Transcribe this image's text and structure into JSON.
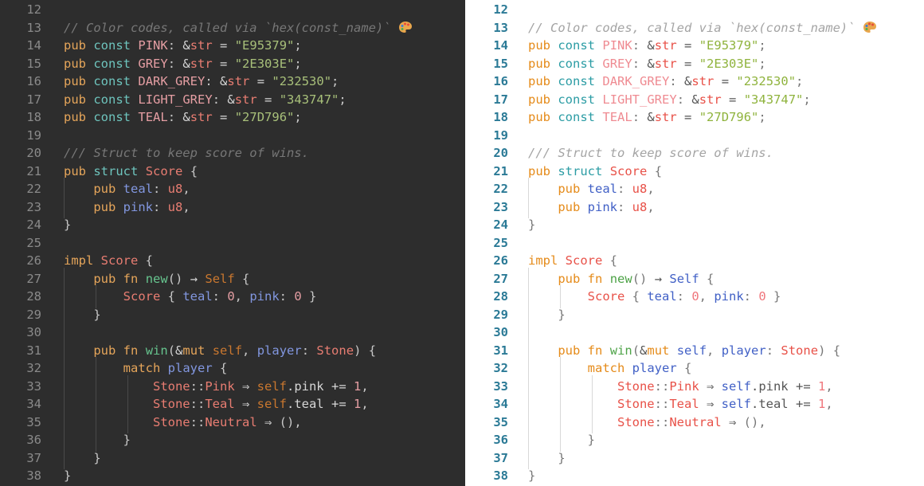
{
  "panels": [
    {
      "theme": "dark",
      "name": "dark-theme-editor"
    },
    {
      "theme": "light",
      "name": "light-theme-editor"
    }
  ],
  "lines": [
    {
      "n": "12",
      "tokens": []
    },
    {
      "n": "13",
      "tokens": [
        [
          "comment",
          "// Color codes, called via `hex(const_name)` "
        ],
        [
          "emoji",
          "palette"
        ]
      ]
    },
    {
      "n": "14",
      "tokens": [
        [
          "kw",
          "pub"
        ],
        [
          "plain",
          " "
        ],
        [
          "kw2",
          "const"
        ],
        [
          "plain",
          " "
        ],
        [
          "const",
          "PINK"
        ],
        [
          "punct",
          ": "
        ],
        [
          "plain",
          "&"
        ],
        [
          "type",
          "str"
        ],
        [
          "op",
          " = "
        ],
        [
          "string",
          "\"E95379\""
        ],
        [
          "punct",
          ";"
        ]
      ]
    },
    {
      "n": "15",
      "tokens": [
        [
          "kw",
          "pub"
        ],
        [
          "plain",
          " "
        ],
        [
          "kw2",
          "const"
        ],
        [
          "plain",
          " "
        ],
        [
          "const",
          "GREY"
        ],
        [
          "punct",
          ": "
        ],
        [
          "plain",
          "&"
        ],
        [
          "type",
          "str"
        ],
        [
          "op",
          " = "
        ],
        [
          "string",
          "\"2E303E\""
        ],
        [
          "punct",
          ";"
        ]
      ]
    },
    {
      "n": "16",
      "tokens": [
        [
          "kw",
          "pub"
        ],
        [
          "plain",
          " "
        ],
        [
          "kw2",
          "const"
        ],
        [
          "plain",
          " "
        ],
        [
          "const",
          "DARK_GREY"
        ],
        [
          "punct",
          ": "
        ],
        [
          "plain",
          "&"
        ],
        [
          "type",
          "str"
        ],
        [
          "op",
          " = "
        ],
        [
          "string",
          "\"232530\""
        ],
        [
          "punct",
          ";"
        ]
      ]
    },
    {
      "n": "17",
      "tokens": [
        [
          "kw",
          "pub"
        ],
        [
          "plain",
          " "
        ],
        [
          "kw2",
          "const"
        ],
        [
          "plain",
          " "
        ],
        [
          "const",
          "LIGHT_GREY"
        ],
        [
          "punct",
          ": "
        ],
        [
          "plain",
          "&"
        ],
        [
          "type",
          "str"
        ],
        [
          "op",
          " = "
        ],
        [
          "string",
          "\"343747\""
        ],
        [
          "punct",
          ";"
        ]
      ]
    },
    {
      "n": "18",
      "tokens": [
        [
          "kw",
          "pub"
        ],
        [
          "plain",
          " "
        ],
        [
          "kw2",
          "const"
        ],
        [
          "plain",
          " "
        ],
        [
          "const",
          "TEAL"
        ],
        [
          "punct",
          ": "
        ],
        [
          "plain",
          "&"
        ],
        [
          "type",
          "str"
        ],
        [
          "op",
          " = "
        ],
        [
          "string",
          "\"27D796\""
        ],
        [
          "punct",
          ";"
        ]
      ]
    },
    {
      "n": "19",
      "tokens": []
    },
    {
      "n": "20",
      "tokens": [
        [
          "comment",
          "/// Struct to keep score of wins."
        ]
      ]
    },
    {
      "n": "21",
      "tokens": [
        [
          "kw",
          "pub"
        ],
        [
          "plain",
          " "
        ],
        [
          "kw2",
          "struct"
        ],
        [
          "plain",
          " "
        ],
        [
          "type",
          "Score"
        ],
        [
          "punct",
          " {"
        ]
      ]
    },
    {
      "n": "22",
      "guides": [
        0
      ],
      "tokens": [
        [
          "plain",
          "    "
        ],
        [
          "kw",
          "pub"
        ],
        [
          "plain",
          " "
        ],
        [
          "field",
          "teal"
        ],
        [
          "punct",
          ": "
        ],
        [
          "type",
          "u8"
        ],
        [
          "punct",
          ","
        ]
      ]
    },
    {
      "n": "23",
      "guides": [
        0
      ],
      "tokens": [
        [
          "plain",
          "    "
        ],
        [
          "kw",
          "pub"
        ],
        [
          "plain",
          " "
        ],
        [
          "field",
          "pink"
        ],
        [
          "punct",
          ": "
        ],
        [
          "type",
          "u8"
        ],
        [
          "punct",
          ","
        ]
      ]
    },
    {
      "n": "24",
      "tokens": [
        [
          "punct",
          "}"
        ]
      ]
    },
    {
      "n": "25",
      "tokens": []
    },
    {
      "n": "26",
      "tokens": [
        [
          "kw",
          "impl"
        ],
        [
          "plain",
          " "
        ],
        [
          "type",
          "Score"
        ],
        [
          "punct",
          " {"
        ]
      ]
    },
    {
      "n": "27",
      "guides": [
        0
      ],
      "tokens": [
        [
          "plain",
          "    "
        ],
        [
          "kw",
          "pub"
        ],
        [
          "plain",
          " "
        ],
        [
          "kw",
          "fn"
        ],
        [
          "plain",
          " "
        ],
        [
          "fn",
          "new"
        ],
        [
          "punct",
          "()"
        ],
        [
          "op",
          " → "
        ],
        [
          "self",
          "Self"
        ],
        [
          "punct",
          " {"
        ]
      ]
    },
    {
      "n": "28",
      "guides": [
        0,
        1
      ],
      "tokens": [
        [
          "plain",
          "        "
        ],
        [
          "type",
          "Score"
        ],
        [
          "punct",
          " { "
        ],
        [
          "field",
          "teal"
        ],
        [
          "punct",
          ": "
        ],
        [
          "num",
          "0"
        ],
        [
          "punct",
          ", "
        ],
        [
          "field",
          "pink"
        ],
        [
          "punct",
          ": "
        ],
        [
          "num",
          "0"
        ],
        [
          "punct",
          " }"
        ]
      ]
    },
    {
      "n": "29",
      "guides": [
        0
      ],
      "tokens": [
        [
          "plain",
          "    "
        ],
        [
          "punct",
          "}"
        ]
      ]
    },
    {
      "n": "30",
      "guides": [
        0
      ],
      "tokens": []
    },
    {
      "n": "31",
      "guides": [
        0
      ],
      "tokens": [
        [
          "plain",
          "    "
        ],
        [
          "kw",
          "pub"
        ],
        [
          "plain",
          " "
        ],
        [
          "kw",
          "fn"
        ],
        [
          "plain",
          " "
        ],
        [
          "fn",
          "win"
        ],
        [
          "punct",
          "("
        ],
        [
          "plain",
          "&"
        ],
        [
          "kw",
          "mut"
        ],
        [
          "plain",
          " "
        ],
        [
          "self",
          "self"
        ],
        [
          "punct",
          ", "
        ],
        [
          "field",
          "player"
        ],
        [
          "punct",
          ": "
        ],
        [
          "type",
          "Stone"
        ],
        [
          "punct",
          ") {"
        ]
      ]
    },
    {
      "n": "32",
      "guides": [
        0,
        1
      ],
      "tokens": [
        [
          "plain",
          "        "
        ],
        [
          "kw",
          "match"
        ],
        [
          "plain",
          " "
        ],
        [
          "field",
          "player"
        ],
        [
          "punct",
          " {"
        ]
      ]
    },
    {
      "n": "33",
      "guides": [
        0,
        1,
        2
      ],
      "tokens": [
        [
          "plain",
          "            "
        ],
        [
          "type",
          "Stone"
        ],
        [
          "punct",
          "::"
        ],
        [
          "type",
          "Pink"
        ],
        [
          "op",
          " ⇒ "
        ],
        [
          "self",
          "self"
        ],
        [
          "plain",
          ".pink"
        ],
        [
          "op",
          " += "
        ],
        [
          "num",
          "1"
        ],
        [
          "punct",
          ","
        ]
      ]
    },
    {
      "n": "34",
      "guides": [
        0,
        1,
        2
      ],
      "tokens": [
        [
          "plain",
          "            "
        ],
        [
          "type",
          "Stone"
        ],
        [
          "punct",
          "::"
        ],
        [
          "type",
          "Teal"
        ],
        [
          "op",
          " ⇒ "
        ],
        [
          "self",
          "self"
        ],
        [
          "plain",
          ".teal"
        ],
        [
          "op",
          " += "
        ],
        [
          "num",
          "1"
        ],
        [
          "punct",
          ","
        ]
      ]
    },
    {
      "n": "35",
      "guides": [
        0,
        1,
        2
      ],
      "tokens": [
        [
          "plain",
          "            "
        ],
        [
          "type",
          "Stone"
        ],
        [
          "punct",
          "::"
        ],
        [
          "type",
          "Neutral"
        ],
        [
          "op",
          " ⇒ "
        ],
        [
          "punct",
          "(),"
        ]
      ]
    },
    {
      "n": "36",
      "guides": [
        0,
        1
      ],
      "tokens": [
        [
          "plain",
          "        "
        ],
        [
          "punct",
          "}"
        ]
      ]
    },
    {
      "n": "37",
      "guides": [
        0
      ],
      "tokens": [
        [
          "plain",
          "    "
        ],
        [
          "punct",
          "}"
        ]
      ]
    },
    {
      "n": "38",
      "tokens": [
        [
          "punct",
          "}"
        ]
      ]
    }
  ]
}
